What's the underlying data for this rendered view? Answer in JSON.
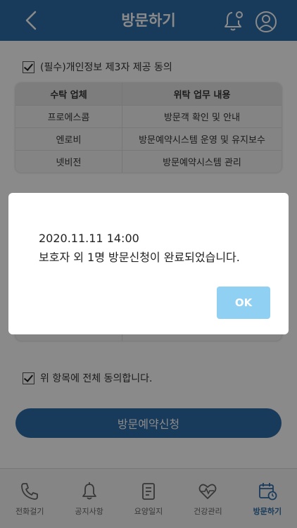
{
  "header": {
    "title": "방문하기",
    "back_icon": "chevron-left-icon",
    "bell_icon": "bell-icon",
    "user_icon": "user-icon"
  },
  "consent": {
    "label": "(필수)개인정보 제3자 제공 동의",
    "checked": true
  },
  "table": {
    "headers": [
      "수탁 업체",
      "위탁 업무 내용"
    ],
    "rows": [
      [
        "프로에스콤",
        "방문객 확인 및 안내"
      ],
      [
        "엔로비",
        "방문예약시스템 운영 및 유지보수"
      ],
      [
        "넷비전",
        "방문예약시스템 관리"
      ]
    ]
  },
  "agree_all": {
    "label": "위 항목에 전체 동의합니다.",
    "checked": true
  },
  "submit_label": "방문예약신청",
  "tabs": [
    {
      "label": "전화걸기",
      "icon": "phone-icon",
      "active": false
    },
    {
      "label": "공지사항",
      "icon": "notice-bell-icon",
      "active": false
    },
    {
      "label": "요양일지",
      "icon": "journal-icon",
      "active": false
    },
    {
      "label": "건강관리",
      "icon": "heart-pulse-icon",
      "active": false
    },
    {
      "label": "방문하기",
      "icon": "calendar-clock-icon",
      "active": true
    }
  ],
  "dialog": {
    "line1": "2020.11.11 14:00",
    "line2": "보호자 외 1명 방문신청이 완료되었습니다.",
    "ok_label": "OK"
  },
  "colors": {
    "primary": "#2f6ea8",
    "ok_button": "#8fd0f3"
  }
}
